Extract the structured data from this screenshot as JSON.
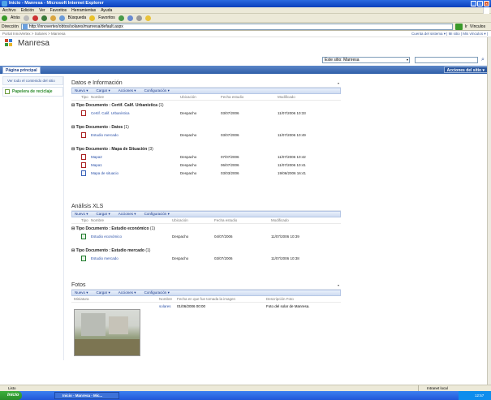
{
  "window": {
    "title": "Inicio - Manresa - Microsoft Internet Explorer"
  },
  "menu": [
    "Archivo",
    "Edición",
    "Ver",
    "Favoritos",
    "Herramientas",
    "Ayuda"
  ],
  "toolbar": {
    "back": "Atrás",
    "search": "Búsqueda",
    "favorites": "Favoritos"
  },
  "address": {
    "label": "Dirección",
    "url": "http://innovertex/obtos/solares/manresa/default.aspx",
    "go": "Ir",
    "links": "Vínculos"
  },
  "breadcrumb": "Portal InnoVertex > Solares > Manresa",
  "top_links": "Cuenta del sistema ▾ | Mi sitio | Mis vínculos ▾ |",
  "site": {
    "name": "Manresa",
    "scope": "Este sitio: Manresa",
    "home_tab": "Página principal",
    "site_actions": "Acciones del sitio ▾"
  },
  "leftnav": {
    "view_all": "Ver todo el contenido del sitio",
    "recycle": "Papelera de reciclaje"
  },
  "tools": [
    "Nuevo ▾",
    "Cargar ▾",
    "Acciones ▾",
    "Configuración ▾"
  ],
  "datos": {
    "title": "Datos e Información",
    "headers": [
      "Tipo",
      "Nombre",
      "Ubicación",
      "Fecha estudio",
      "Modificado"
    ],
    "groups": [
      {
        "label": "Tipo Documento : Certif. Calif. Urbanística",
        "count": "(1)",
        "rows": [
          {
            "name": "Certif. Calif. Urbanística",
            "loc": "Despacho",
            "date": "03/07/2006",
            "mod": "11/07/2006 10:33"
          }
        ]
      },
      {
        "label": "Tipo Documento : Datos",
        "count": "(1)",
        "rows": [
          {
            "name": "Estudio mercado",
            "loc": "Despacho",
            "date": "03/07/2006",
            "mod": "11/07/2006 10:49"
          }
        ]
      },
      {
        "label": "Tipo Documento : Mapa de Situación",
        "count": "(3)",
        "rows": [
          {
            "name": "Mapa2",
            "loc": "Despacho",
            "date": "07/07/2006",
            "mod": "11/07/2006 10:42"
          },
          {
            "name": "Mapa1",
            "loc": "Despacho",
            "date": "06/07/2006",
            "mod": "11/07/2006 10:41"
          },
          {
            "name": "Mapa de situacio",
            "loc": "Despacho",
            "date": "03/03/2006",
            "mod": "19/06/2006 16:41"
          }
        ]
      }
    ]
  },
  "analisis": {
    "title": "Análisis XLS",
    "headers": [
      "Tipo",
      "Nombre",
      "Ubicación",
      "Fecha estudio",
      "Modificado"
    ],
    "groups": [
      {
        "label": "Tipo Documento : Estudio económico",
        "count": "(1)",
        "rows": [
          {
            "name": "Estudio económico",
            "loc": "Despacho",
            "date": "04/07/2006",
            "mod": "11/07/2006 10:39"
          }
        ]
      },
      {
        "label": "Tipo Documento : Estudio mercado",
        "count": "(1)",
        "rows": [
          {
            "name": "Estudio mercado",
            "loc": "Despacho",
            "date": "03/07/2006",
            "mod": "11/07/2006 10:38"
          }
        ]
      }
    ]
  },
  "fotos": {
    "title": "Fotos",
    "headers": [
      "Miniatura",
      "Nombre",
      "Fecha en que fue tomada la imagen",
      "Descripción Foto"
    ],
    "row": {
      "name": "solares",
      "date": "01/06/2006 00:00",
      "desc": "Foto del solar de Manresa."
    }
  },
  "status": {
    "left": "Listo",
    "zone": "Intranet local"
  },
  "taskbar": {
    "start": "Inicio",
    "app": "Inicio - Manresa - Mic...",
    "clock": "12:57"
  }
}
